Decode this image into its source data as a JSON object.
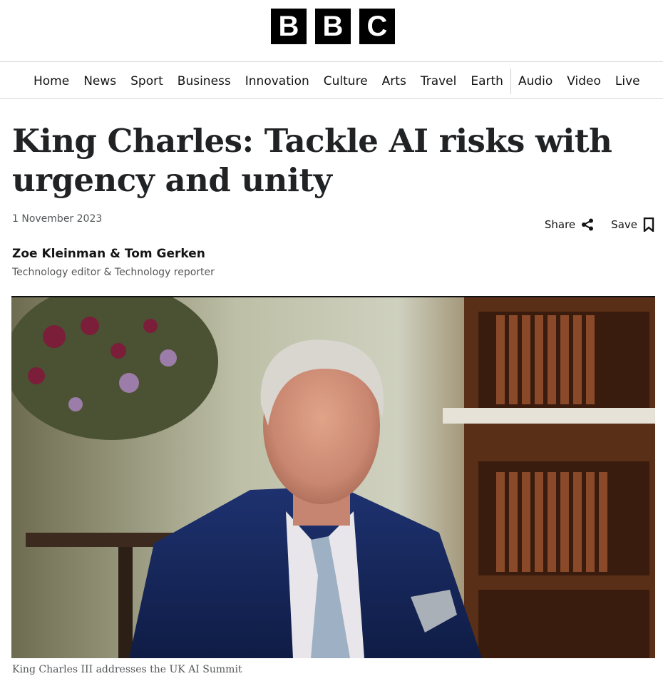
{
  "brand": {
    "logo_letters": [
      "B",
      "B",
      "C"
    ]
  },
  "nav": {
    "items_primary": [
      "Home",
      "News",
      "Sport",
      "Business",
      "Innovation",
      "Culture",
      "Arts",
      "Travel",
      "Earth"
    ],
    "items_secondary": [
      "Audio",
      "Video",
      "Live"
    ]
  },
  "article": {
    "headline": "King Charles: Tackle AI risks with urgency and unity",
    "date": "1 November 2023",
    "authors": "Zoe Kleinman & Tom Gerken",
    "roles": "Technology editor & Technology reporter",
    "caption": "King Charles III addresses the UK AI Summit"
  },
  "actions": {
    "share_label": "Share",
    "save_label": "Save",
    "share_icon": "share-icon",
    "save_icon": "bookmark-icon"
  },
  "colors": {
    "brand_black": "#000000",
    "text_primary": "#141414",
    "text_secondary": "#545658",
    "divider": "#d9d9d9"
  }
}
